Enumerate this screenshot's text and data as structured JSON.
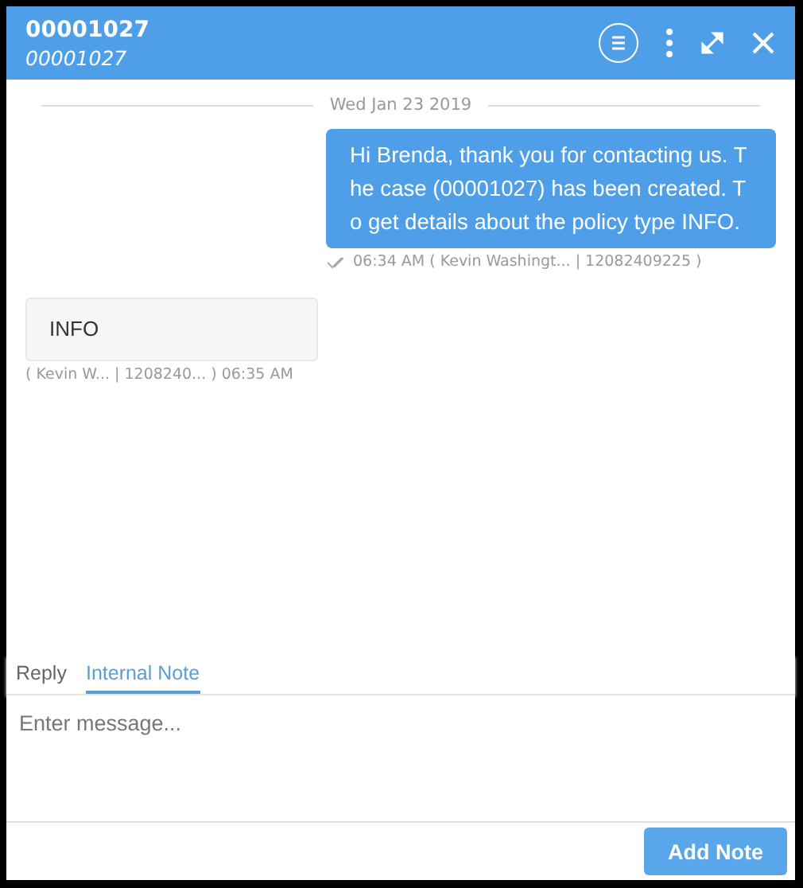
{
  "header": {
    "title": "00001027",
    "subtitle": "00001027"
  },
  "date_divider": "Wed Jan 23 2019",
  "messages": [
    {
      "kind": "outgoing",
      "text": "Hi Brenda, thank you for contacting us. The case (00001027) has been created. To get details about the policy type INFO.",
      "meta": "06:34 AM ( Kevin Washingt... | 12082409225 )",
      "delivered": true
    },
    {
      "kind": "incoming",
      "text": "INFO",
      "meta": "( Kevin W... | 1208240... ) 06:35 AM"
    }
  ],
  "tabs": [
    {
      "label": "Reply",
      "selected": false
    },
    {
      "label": "Internal Note",
      "selected": true
    }
  ],
  "composer": {
    "placeholder": "Enter message..."
  },
  "button": "Add Note"
}
